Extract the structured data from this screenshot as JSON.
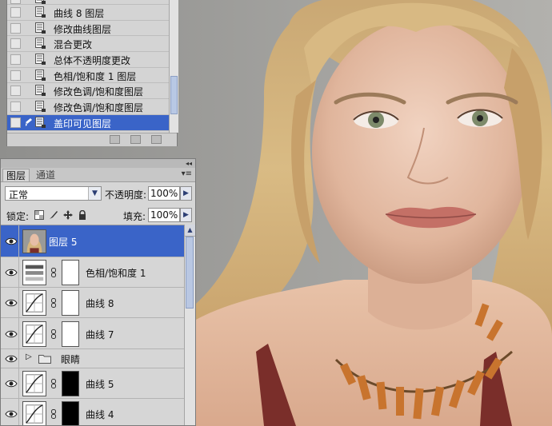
{
  "history": {
    "items": [
      {
        "label": "",
        "selected": false
      },
      {
        "label": "曲线 8 图层",
        "selected": false
      },
      {
        "label": "修改曲线图层",
        "selected": false
      },
      {
        "label": "混合更改",
        "selected": false
      },
      {
        "label": "总体不透明度更改",
        "selected": false
      },
      {
        "label": "色相/饱和度 1 图层",
        "selected": false
      },
      {
        "label": "修改色调/饱和度图层",
        "selected": false
      },
      {
        "label": "修改色调/饱和度图层",
        "selected": false
      },
      {
        "label": "盖印可见图层",
        "selected": true
      }
    ]
  },
  "layers_panel": {
    "collapse_glyph": "◂◂",
    "menu_glyph": "▾≡",
    "tabs": [
      {
        "label": "图层",
        "active": true
      },
      {
        "label": "通道",
        "active": false
      }
    ],
    "blend_mode": "正常",
    "opacity_label": "不透明度:",
    "opacity_value": "100%",
    "lock_label": "锁定:",
    "fill_label": "填充:",
    "fill_value": "100%",
    "layers": [
      {
        "name": "图层 5",
        "type": "pixel",
        "selected": true
      },
      {
        "name": "色相/饱和度 1",
        "type": "hue-saturation",
        "mask": "white",
        "selected": false
      },
      {
        "name": "曲线 8",
        "type": "curves",
        "mask": "white",
        "selected": false
      },
      {
        "name": "曲线 7",
        "type": "curves",
        "mask": "white",
        "selected": false
      },
      {
        "name": "眼睛",
        "type": "group",
        "selected": false
      },
      {
        "name": "曲线 5",
        "type": "curves",
        "mask": "black",
        "selected": false
      },
      {
        "name": "曲线 4",
        "type": "curves",
        "mask": "black",
        "selected": false
      }
    ]
  },
  "colors": {
    "selection": "#3a64c8",
    "panel_bg": "#d6d6d6",
    "canvas_bg": "#9a9a98"
  }
}
